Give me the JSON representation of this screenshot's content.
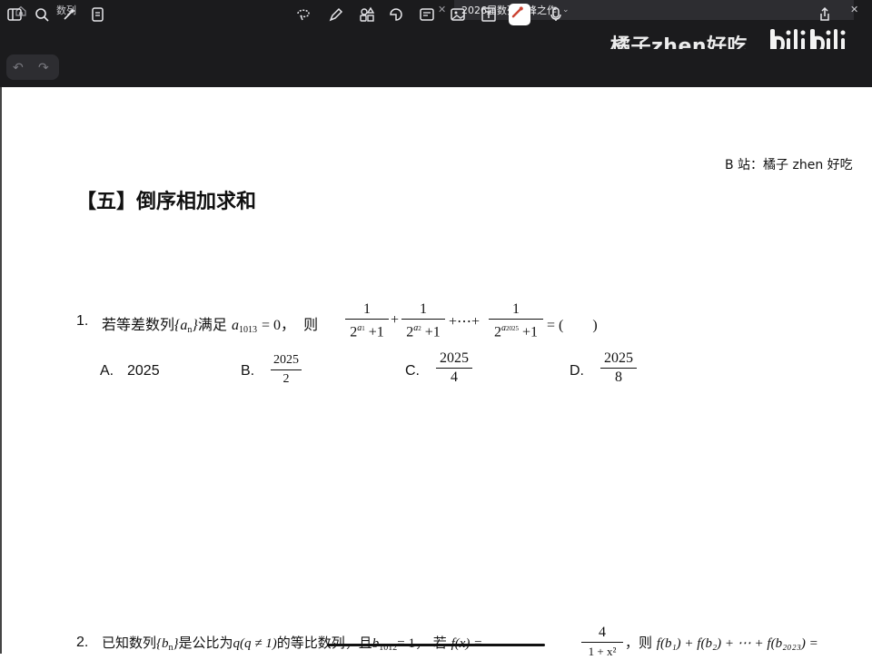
{
  "tabs": [
    {
      "label": "数列"
    },
    {
      "label": "2026届数列巅峰之作"
    }
  ],
  "watermark": {
    "text": "橘子zhen好吃"
  },
  "page": {
    "credit": "B 站：橘子 zhen 好吃",
    "section_title": "【五】倒序相加求和",
    "q1": {
      "number": "1.",
      "lead": "若等差数列",
      "seq": "a",
      "seq_sub": "n",
      "cond_word": "满足",
      "cond_var": "a",
      "cond_sub": "1013",
      "cond_eq": "= 0，",
      "then": "则",
      "term1_den_exp": "a",
      "term1_den_exp_sub": "1",
      "term2_den_exp_sub": "2",
      "term3_den_exp_sub": "2025",
      "numerator": "1",
      "den_base": "2",
      "den_tail": "+1",
      "plus": "+",
      "ellipsis": "+⋯+",
      "equals": "= (　　)",
      "options": [
        {
          "letter": "A.",
          "value": "2025"
        },
        {
          "letter": "B.",
          "num": "2025",
          "den": "2"
        },
        {
          "letter": "C.",
          "num": "2025",
          "den": "4"
        },
        {
          "letter": "D.",
          "num": "2025",
          "den": "8"
        }
      ]
    },
    "q2": {
      "number": "2.",
      "text_a": "已知数列",
      "seq": "b",
      "seq_sub": "n",
      "text_b": "是公比为",
      "q_part": "q(q ≠ 1)",
      "text_c": "的等比数列，且",
      "b_cond": "b",
      "b_cond_sub": "1012",
      "b_cond_eq": "= 1，",
      "text_d": "若",
      "f_def": "f(x) =",
      "f_num": "4",
      "f_den": "1 + x²",
      "text_e": "，则",
      "sum_expr": "f(b₁) + f(b₂) + ⋯ + f(b₂₀₂₃) ="
    }
  }
}
